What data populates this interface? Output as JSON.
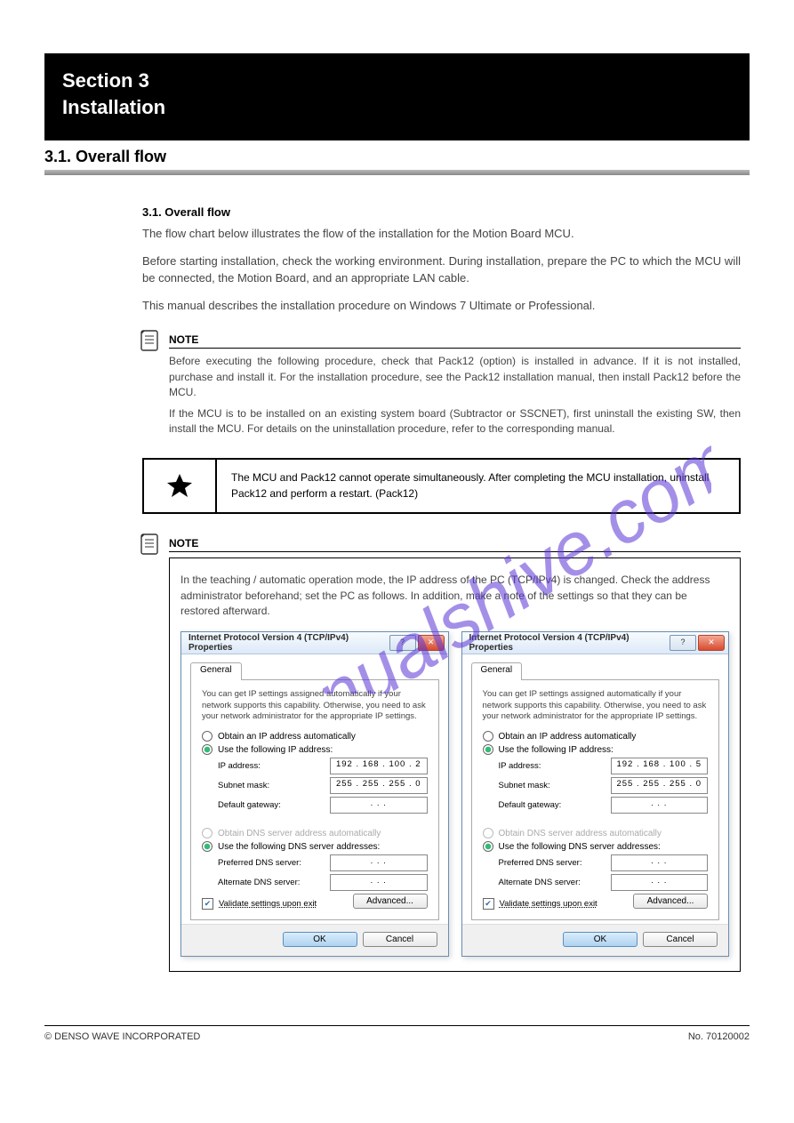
{
  "header": {
    "section_num": "Section 3",
    "section_title": "Installation",
    "subtitle": "3.1. Overall flow"
  },
  "overview_title": "3.1. Overall flow",
  "overview_para1": "The flow chart below illustrates the flow of the installation for the Motion Board MCU.",
  "overview_para2": "Before starting installation, check the working environment. During installation, prepare the PC to which the MCU will be connected, the Motion Board, and an appropriate LAN cable.",
  "overview_para3": "This manual describes the installation procedure on Windows 7 Ultimate or Professional.",
  "note1": {
    "label": "NOTE",
    "text1": "Before executing the following procedure, check that Pack12 (option) is installed in advance. If it is not installed, purchase and install it. For the installation procedure, see the Pack12 installation manual, then install Pack12 before the MCU.",
    "text2": "If the MCU is to be installed on an existing system board (Subtractor or SSCNET), first uninstall the existing SW, then install the MCU. For details on the uninstallation procedure, refer to the corresponding manual."
  },
  "warn": {
    "text": "The MCU and Pack12 cannot operate simultaneously. After completing the MCU installation, uninstall Pack12 and perform a restart.                                                                         (Pack12)"
  },
  "note2": {
    "label": "NOTE",
    "paragraph": "In the teaching / automatic operation mode, the IP address of the PC (TCP/IPv4) is changed. Check the address administrator beforehand; set the PC as follows. In addition, make a note of the settings so that they can be restored afterward."
  },
  "dialog": {
    "title": "Internet Protocol Version 4 (TCP/IPv4) Properties",
    "tab": "General",
    "info": "You can get IP settings assigned automatically if your network supports this capability. Otherwise, you need to ask your network administrator for the appropriate IP settings.",
    "radio_obtain_ip": "Obtain an IP address automatically",
    "radio_use_ip": "Use the following IP address:",
    "label_ip": "IP address:",
    "label_mask": "Subnet mask:",
    "label_gateway": "Default gateway:",
    "radio_obtain_dns": "Obtain DNS server address automatically",
    "radio_use_dns": "Use the following DNS server addresses:",
    "label_pref_dns": "Preferred DNS server:",
    "label_alt_dns": "Alternate DNS server:",
    "chk_validate": "Validate settings upon exit",
    "btn_advanced": "Advanced...",
    "btn_ok": "OK",
    "btn_cancel": "Cancel"
  },
  "dialog_left": {
    "ip": "192 . 168 . 100 .   2",
    "mask": "255 . 255 . 255 .   0",
    "gateway": ".       .       .",
    "pref": ".       .       .",
    "alt": ".       .       ."
  },
  "dialog_right": {
    "ip": "192 . 168 . 100 .   5",
    "mask": "255 . 255 . 255 .   0",
    "gateway": ".       .       .",
    "pref": ".       .       .",
    "alt": ".       .       ."
  },
  "footer": {
    "left": "© DENSO WAVE INCORPORATED",
    "right_label": "No.",
    "right_value": "70120002"
  },
  "watermark_text": "manualshive.com"
}
